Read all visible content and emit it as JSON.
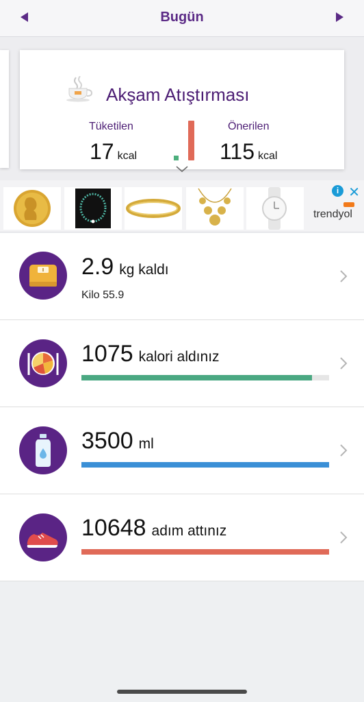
{
  "header": {
    "title": "Bugün"
  },
  "meal": {
    "title": "Akşam Atıştırması",
    "consumed_label": "Tüketilen",
    "consumed_value": "17",
    "consumed_unit": "kcal",
    "recommended_label": "Önerilen",
    "recommended_value": "115",
    "recommended_unit": "kcal",
    "colors": {
      "consumed": "#4caf7d",
      "recommended": "#e06a58"
    }
  },
  "ad": {
    "brand": "trendyol",
    "items": [
      "gold-coin",
      "bead-necklace",
      "gold-bracelet",
      "coin-necklace",
      "white-watch"
    ]
  },
  "stats": {
    "weight": {
      "value": "2.9",
      "unit": "kg kaldı",
      "sub": "Kilo 55.9"
    },
    "calories": {
      "value": "1075",
      "unit": "kalori aldınız",
      "progress": 0.93,
      "color": "#4aa882"
    },
    "water": {
      "value": "3500",
      "unit": "ml",
      "progress": 1.0,
      "color": "#3a8fd6"
    },
    "steps": {
      "value": "10648",
      "unit": "adım attınız",
      "progress": 1.0,
      "color": "#e06a58"
    }
  }
}
